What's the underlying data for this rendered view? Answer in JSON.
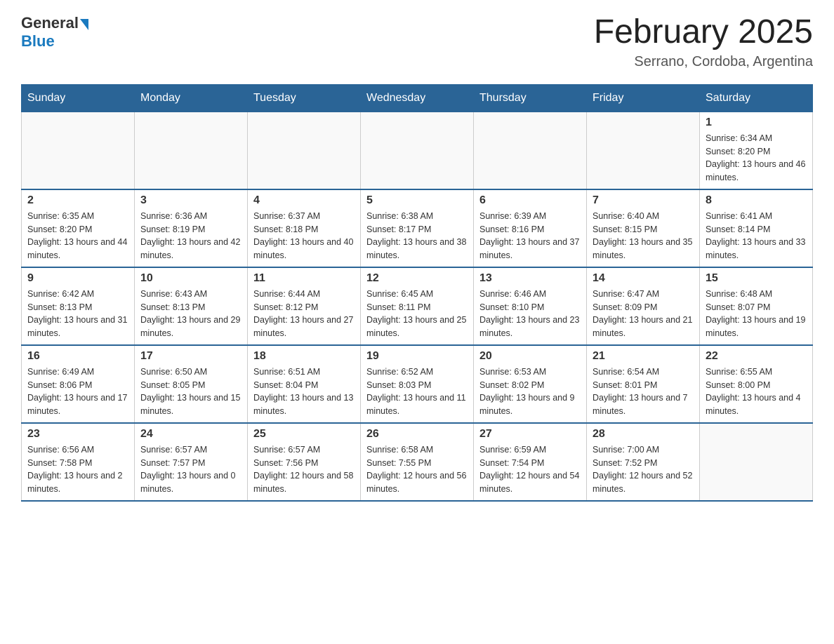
{
  "header": {
    "logo_general": "General",
    "logo_blue": "Blue",
    "month_year": "February 2025",
    "location": "Serrano, Cordoba, Argentina"
  },
  "days_of_week": [
    "Sunday",
    "Monday",
    "Tuesday",
    "Wednesday",
    "Thursday",
    "Friday",
    "Saturday"
  ],
  "weeks": [
    [
      {
        "day": "",
        "info": ""
      },
      {
        "day": "",
        "info": ""
      },
      {
        "day": "",
        "info": ""
      },
      {
        "day": "",
        "info": ""
      },
      {
        "day": "",
        "info": ""
      },
      {
        "day": "",
        "info": ""
      },
      {
        "day": "1",
        "info": "Sunrise: 6:34 AM\nSunset: 8:20 PM\nDaylight: 13 hours and 46 minutes."
      }
    ],
    [
      {
        "day": "2",
        "info": "Sunrise: 6:35 AM\nSunset: 8:20 PM\nDaylight: 13 hours and 44 minutes."
      },
      {
        "day": "3",
        "info": "Sunrise: 6:36 AM\nSunset: 8:19 PM\nDaylight: 13 hours and 42 minutes."
      },
      {
        "day": "4",
        "info": "Sunrise: 6:37 AM\nSunset: 8:18 PM\nDaylight: 13 hours and 40 minutes."
      },
      {
        "day": "5",
        "info": "Sunrise: 6:38 AM\nSunset: 8:17 PM\nDaylight: 13 hours and 38 minutes."
      },
      {
        "day": "6",
        "info": "Sunrise: 6:39 AM\nSunset: 8:16 PM\nDaylight: 13 hours and 37 minutes."
      },
      {
        "day": "7",
        "info": "Sunrise: 6:40 AM\nSunset: 8:15 PM\nDaylight: 13 hours and 35 minutes."
      },
      {
        "day": "8",
        "info": "Sunrise: 6:41 AM\nSunset: 8:14 PM\nDaylight: 13 hours and 33 minutes."
      }
    ],
    [
      {
        "day": "9",
        "info": "Sunrise: 6:42 AM\nSunset: 8:13 PM\nDaylight: 13 hours and 31 minutes."
      },
      {
        "day": "10",
        "info": "Sunrise: 6:43 AM\nSunset: 8:13 PM\nDaylight: 13 hours and 29 minutes."
      },
      {
        "day": "11",
        "info": "Sunrise: 6:44 AM\nSunset: 8:12 PM\nDaylight: 13 hours and 27 minutes."
      },
      {
        "day": "12",
        "info": "Sunrise: 6:45 AM\nSunset: 8:11 PM\nDaylight: 13 hours and 25 minutes."
      },
      {
        "day": "13",
        "info": "Sunrise: 6:46 AM\nSunset: 8:10 PM\nDaylight: 13 hours and 23 minutes."
      },
      {
        "day": "14",
        "info": "Sunrise: 6:47 AM\nSunset: 8:09 PM\nDaylight: 13 hours and 21 minutes."
      },
      {
        "day": "15",
        "info": "Sunrise: 6:48 AM\nSunset: 8:07 PM\nDaylight: 13 hours and 19 minutes."
      }
    ],
    [
      {
        "day": "16",
        "info": "Sunrise: 6:49 AM\nSunset: 8:06 PM\nDaylight: 13 hours and 17 minutes."
      },
      {
        "day": "17",
        "info": "Sunrise: 6:50 AM\nSunset: 8:05 PM\nDaylight: 13 hours and 15 minutes."
      },
      {
        "day": "18",
        "info": "Sunrise: 6:51 AM\nSunset: 8:04 PM\nDaylight: 13 hours and 13 minutes."
      },
      {
        "day": "19",
        "info": "Sunrise: 6:52 AM\nSunset: 8:03 PM\nDaylight: 13 hours and 11 minutes."
      },
      {
        "day": "20",
        "info": "Sunrise: 6:53 AM\nSunset: 8:02 PM\nDaylight: 13 hours and 9 minutes."
      },
      {
        "day": "21",
        "info": "Sunrise: 6:54 AM\nSunset: 8:01 PM\nDaylight: 13 hours and 7 minutes."
      },
      {
        "day": "22",
        "info": "Sunrise: 6:55 AM\nSunset: 8:00 PM\nDaylight: 13 hours and 4 minutes."
      }
    ],
    [
      {
        "day": "23",
        "info": "Sunrise: 6:56 AM\nSunset: 7:58 PM\nDaylight: 13 hours and 2 minutes."
      },
      {
        "day": "24",
        "info": "Sunrise: 6:57 AM\nSunset: 7:57 PM\nDaylight: 13 hours and 0 minutes."
      },
      {
        "day": "25",
        "info": "Sunrise: 6:57 AM\nSunset: 7:56 PM\nDaylight: 12 hours and 58 minutes."
      },
      {
        "day": "26",
        "info": "Sunrise: 6:58 AM\nSunset: 7:55 PM\nDaylight: 12 hours and 56 minutes."
      },
      {
        "day": "27",
        "info": "Sunrise: 6:59 AM\nSunset: 7:54 PM\nDaylight: 12 hours and 54 minutes."
      },
      {
        "day": "28",
        "info": "Sunrise: 7:00 AM\nSunset: 7:52 PM\nDaylight: 12 hours and 52 minutes."
      },
      {
        "day": "",
        "info": ""
      }
    ]
  ]
}
